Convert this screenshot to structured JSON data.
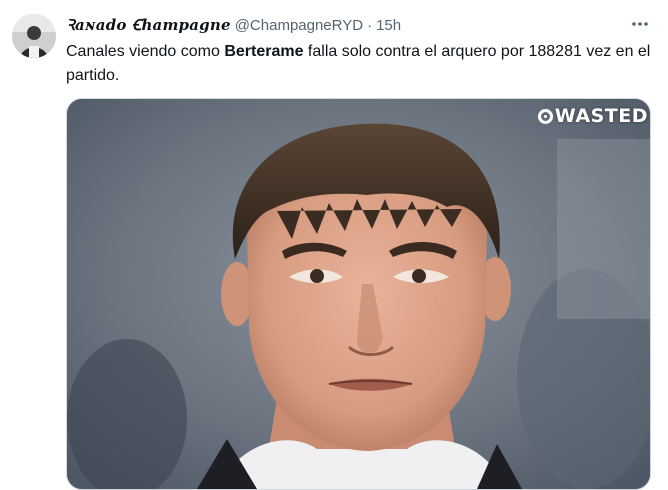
{
  "tweet": {
    "display_name": "Ꝛaɴado Ꞓhampagne",
    "handle": "@ChampagneRYD",
    "separator": "·",
    "time": "15h",
    "more_icon": "more-horizontal-icon",
    "text_before": "Canales viendo como ",
    "text_bold": "Berterame",
    "text_after": " falla solo contra el arquero por 188281 vez en el partido."
  },
  "media": {
    "watermark": "WASTED",
    "watermark_icon": "wasted-logo-icon"
  },
  "colors": {
    "text": "#0f1419",
    "muted": "#536471",
    "border": "#cfd9de"
  }
}
